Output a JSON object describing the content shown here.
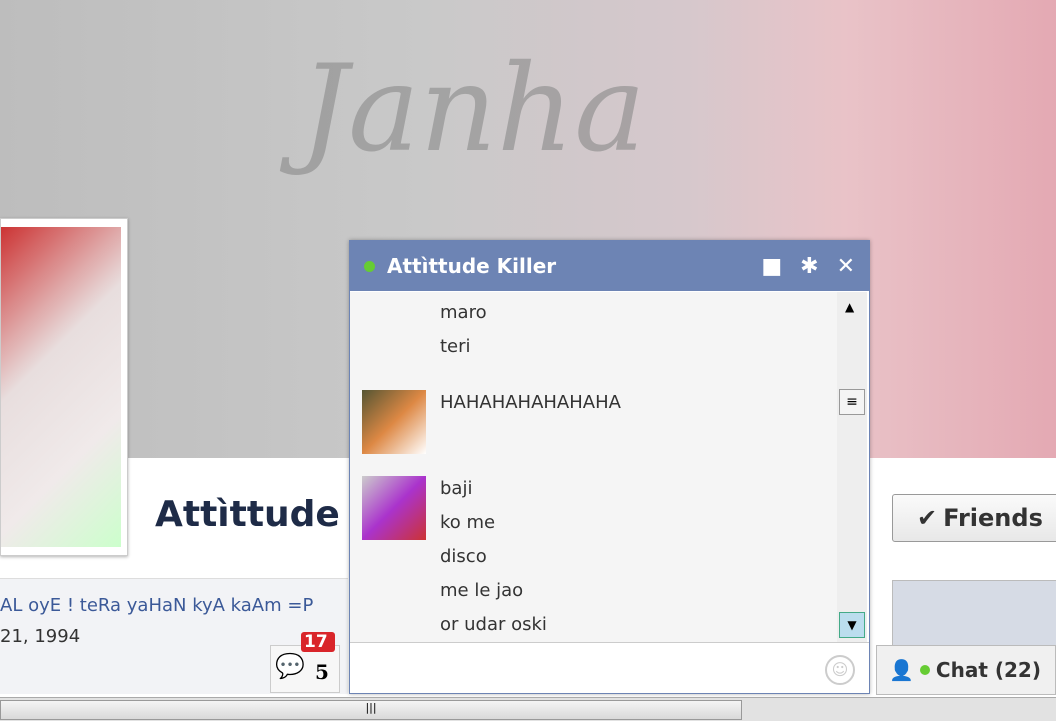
{
  "profile": {
    "name": "Attìttude K",
    "status": "AL oyE ! teRa yaHaN kyA kaAm =P",
    "birthday": "21, 1994",
    "friends_button": "Friends",
    "cover_text": "Janha"
  },
  "notifications": {
    "badge": "17",
    "count": "5"
  },
  "chat_window": {
    "title": "Attìttude Killer",
    "messages": [
      {
        "text": "maro"
      },
      {
        "text": "teri"
      },
      {
        "text": "HAHAHAHAHAHAHA"
      },
      {
        "text": "baji"
      },
      {
        "text": "ko me"
      },
      {
        "text": "disco"
      },
      {
        "text": "me le jao"
      },
      {
        "text": "or udar oski"
      }
    ]
  },
  "chat_bar": {
    "label": "Chat (22)"
  },
  "colors": {
    "header": "#6d84b4",
    "online": "#66cc33",
    "badge": "#d9252a"
  }
}
